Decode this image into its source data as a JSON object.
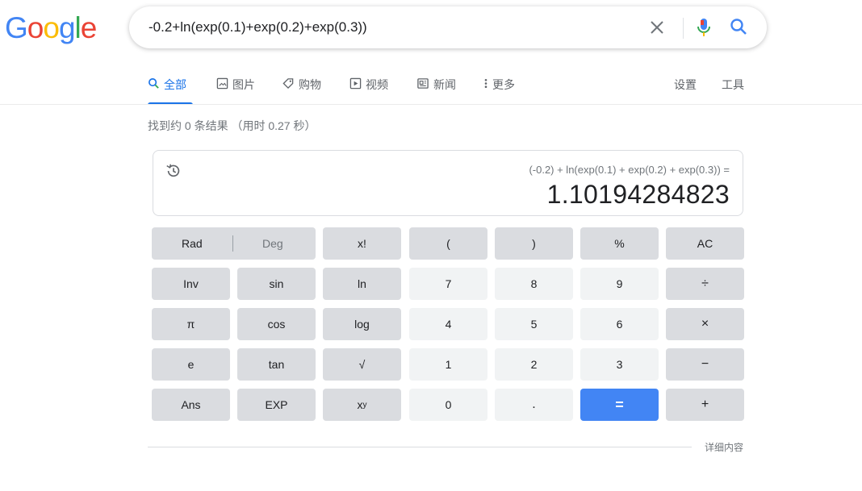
{
  "logo": {
    "letters": [
      "G",
      "o",
      "o",
      "g",
      "l",
      "e"
    ],
    "colors": [
      "#4285f4",
      "#ea4335",
      "#fbbc05",
      "#4285f4",
      "#34a853",
      "#ea4335"
    ]
  },
  "search": {
    "query": "-0.2+ln(exp(0.1)+exp(0.2)+exp(0.3))",
    "icons": [
      "close-icon",
      "microphone-icon",
      "search-icon"
    ]
  },
  "tabs": [
    {
      "label": "全部",
      "icon": "search-icon"
    },
    {
      "label": "图片",
      "icon": "image-icon"
    },
    {
      "label": "购物",
      "icon": "tag-icon"
    },
    {
      "label": "视频",
      "icon": "play-icon"
    },
    {
      "label": "新闻",
      "icon": "newspaper-icon"
    },
    {
      "label": "更多",
      "icon": "more-vert-icon"
    }
  ],
  "tools": {
    "settings": "设置",
    "tools": "工具"
  },
  "result_stats": "找到约 0 条结果 （用时 0.27 秒）",
  "calculator": {
    "expression": "(-0.2) + ln(exp(0.1) + exp(0.2) + exp(0.3)) =",
    "result": "1.10194284823",
    "rad": "Rad",
    "deg": "Deg",
    "keys": {
      "fact": "x!",
      "lparen": "(",
      "rparen": ")",
      "percent": "%",
      "ac": "AC",
      "inv": "Inv",
      "sin": "sin",
      "ln": "ln",
      "n7": "7",
      "n8": "8",
      "n9": "9",
      "div": "÷",
      "pi": "π",
      "cos": "cos",
      "log": "log",
      "n4": "4",
      "n5": "5",
      "n6": "6",
      "mul": "×",
      "e": "e",
      "tan": "tan",
      "sqrt": "√",
      "n1": "1",
      "n2": "2",
      "n3": "3",
      "sub": "−",
      "ans": "Ans",
      "exp": "EXP",
      "pow_base": "x",
      "pow_exp": "y",
      "n0": "0",
      "dot": ".",
      "eq": "=",
      "add": "+"
    },
    "accent_color": "#4285f4"
  },
  "more_info": "详细内容"
}
